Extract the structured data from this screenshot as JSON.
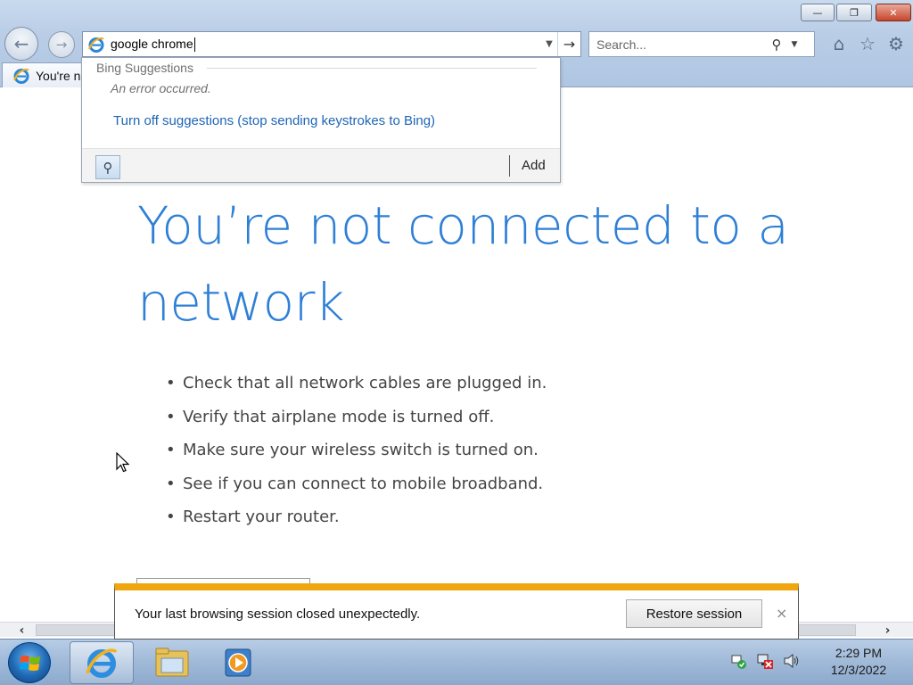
{
  "window": {
    "minimize_icon": "minimize-icon",
    "maximize_icon": "restore-icon",
    "close_icon": "close-icon"
  },
  "nav": {
    "back_icon": "back-arrow-icon",
    "forward_icon": "forward-arrow-icon"
  },
  "address_bar": {
    "value": "google chrome",
    "dropdown_icon": "chevron-down-icon",
    "go_icon": "go-arrow-icon"
  },
  "search_box": {
    "placeholder": "Search...",
    "search_icon": "magnifier-icon",
    "dropdown_icon": "chevron-down-icon"
  },
  "toolbar": {
    "icons": [
      "home-icon",
      "favorites-star-icon",
      "gear-icon"
    ]
  },
  "tab": {
    "label": "You're n"
  },
  "suggestions": {
    "header": "Bing Suggestions",
    "error": "An error occurred.",
    "turn_off_link": "Turn off suggestions (stop sending keystrokes to Bing)",
    "add_label": "Add"
  },
  "page": {
    "headline": "You’re not connected to a network",
    "tips": [
      "Check that all network cables are plugged in.",
      "Verify that airplane mode is turned off.",
      "Make sure your wireless switch is turned on.",
      "See if you can connect to mobile broadband.",
      "Restart your router."
    ]
  },
  "notification": {
    "message": "Your last browsing session closed unexpectedly.",
    "restore_label": "Restore session",
    "close_glyph": "×"
  },
  "taskbar": {
    "apps": [
      "internet-explorer-icon",
      "windows-explorer-icon",
      "windows-media-player-icon"
    ],
    "tray_icons": [
      "action-center-icon",
      "network-disconnected-icon",
      "volume-icon"
    ],
    "time": "2:29 PM",
    "date": "12/3/2022"
  },
  "colors": {
    "headline": "#2e7fd6",
    "link": "#1f66b5",
    "notification_accent": "#f0a70f"
  }
}
